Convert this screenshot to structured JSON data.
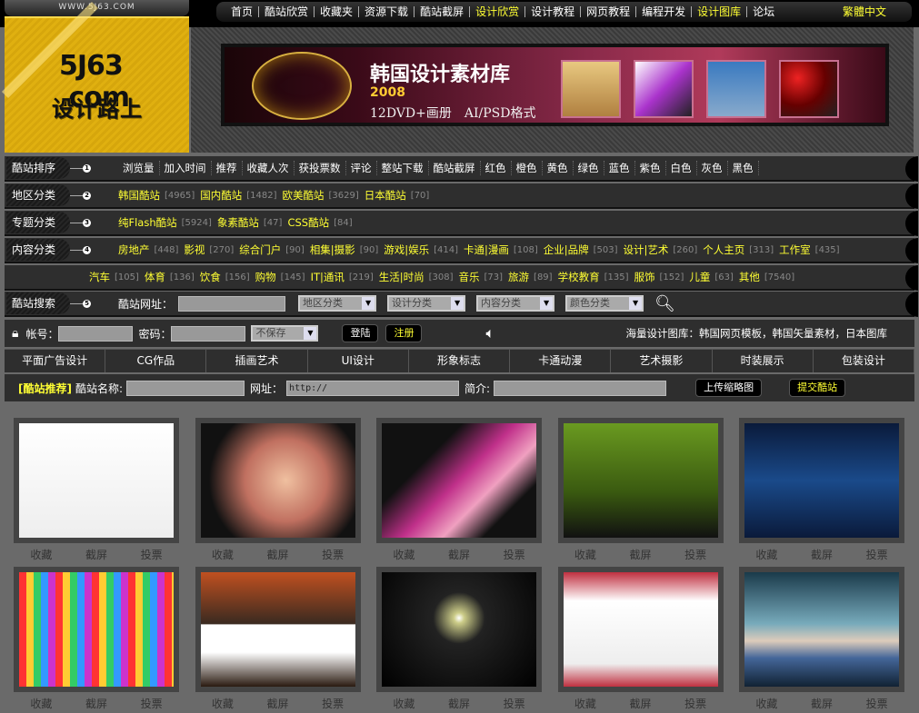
{
  "site_url": "WWW.5J63.COM",
  "logo": {
    "mark": "5J63 .com",
    "slogan": "设计路上"
  },
  "nav": [
    {
      "label": "首页"
    },
    {
      "label": "酷站欣赏"
    },
    {
      "label": "收藏夹"
    },
    {
      "label": "资源下载"
    },
    {
      "label": "酷站截屏"
    },
    {
      "label": "设计欣赏",
      "hl": true
    },
    {
      "label": "设计教程"
    },
    {
      "label": "网页教程"
    },
    {
      "label": "编程开发"
    },
    {
      "label": "设计图库",
      "hl": true
    },
    {
      "label": "论坛"
    }
  ],
  "nav_traditional": "繁體中文",
  "banner": {
    "title": "韩国设计素材库",
    "year": "2008",
    "subtitle": "12DVD+画册　AI/PSD格式"
  },
  "rows": {
    "sort": {
      "label": "酷站排序",
      "num": "1",
      "items": [
        "浏览量",
        "加入时间",
        "推荐",
        "收藏人次",
        "获投票数",
        "评论",
        "整站下载",
        "酷站截屏",
        "红色",
        "橙色",
        "黄色",
        "绿色",
        "蓝色",
        "紫色",
        "白色",
        "灰色",
        "黑色"
      ]
    },
    "region": {
      "label": "地区分类",
      "num": "2",
      "items": [
        {
          "name": "韩国酷站",
          "count": "[4965]"
        },
        {
          "name": "国内酷站",
          "count": "[1482]"
        },
        {
          "name": "欧美酷站",
          "count": "[3629]"
        },
        {
          "name": "日本酷站",
          "count": "[70]"
        }
      ]
    },
    "topic": {
      "label": "专题分类",
      "num": "3",
      "items": [
        {
          "name": "纯Flash酷站",
          "count": "[5924]"
        },
        {
          "name": "象素酷站",
          "count": "[47]"
        },
        {
          "name": "CSS酷站",
          "count": "[84]"
        }
      ]
    },
    "content": {
      "label": "内容分类",
      "num": "4",
      "items": [
        {
          "name": "房地产",
          "count": "[448]"
        },
        {
          "name": "影视",
          "count": "[270]"
        },
        {
          "name": "综合门户",
          "count": "[90]"
        },
        {
          "name": "相集|摄影",
          "count": "[90]"
        },
        {
          "name": "游戏|娱乐",
          "count": "[414]"
        },
        {
          "name": "卡通|漫画",
          "count": "[108]"
        },
        {
          "name": "企业|品牌",
          "count": "[503]"
        },
        {
          "name": "设计|艺术",
          "count": "[260]"
        },
        {
          "name": "个人主页",
          "count": "[313]"
        },
        {
          "name": "工作室",
          "count": "[435]"
        }
      ],
      "items2": [
        {
          "name": "汽车",
          "count": "[105]"
        },
        {
          "name": "体育",
          "count": "[136]"
        },
        {
          "name": "饮食",
          "count": "[156]"
        },
        {
          "name": "购物",
          "count": "[145]"
        },
        {
          "name": "IT|通讯",
          "count": "[219]"
        },
        {
          "name": "生活|时尚",
          "count": "[308]"
        },
        {
          "name": "音乐",
          "count": "[73]"
        },
        {
          "name": "旅游",
          "count": "[89]"
        },
        {
          "name": "学校教育",
          "count": "[135]"
        },
        {
          "name": "服饰",
          "count": "[152]"
        },
        {
          "name": "儿童",
          "count": "[63]"
        },
        {
          "name": "其他",
          "count": "[7540]"
        }
      ]
    },
    "search": {
      "label": "酷站搜索",
      "num": "5",
      "url_label": "酷站网址：",
      "selects": [
        "地区分类",
        "设计分类",
        "内容分类",
        "颜色分类"
      ]
    }
  },
  "login": {
    "account_label": "帐号：",
    "password_label": "密码：",
    "remember": "不保存",
    "login_btn": "登陆",
    "register_btn": "注册",
    "marquee": "海量设计图库：韩国网页模板，韩国矢量素材，日本图库"
  },
  "tabs": [
    "平面广告设计",
    "CG作品",
    "插画艺术",
    "UI设计",
    "形象标志",
    "卡通动漫",
    "艺术摄影",
    "时装展示",
    "包装设计"
  ],
  "recommend": {
    "tag": "[酷站推荐]",
    "name_label": "酷站名称:",
    "url_label": "网址：",
    "url_value": "http://",
    "intro_label": "简介:",
    "upload_btn": "上传缩略图",
    "submit_btn": "提交酷站"
  },
  "actions": [
    "收藏",
    "截屏",
    "投票"
  ],
  "thumbnails": [
    {
      "bg": "linear-gradient(#fff,#eee)"
    },
    {
      "bg": "radial-gradient(circle at 55% 50%,#f0c0a0,#c07060 40%,#111 75%)"
    },
    {
      "bg": "linear-gradient(135deg,#111 30%,#c0308a 50%,#f0a0c0 65%,#111 80%)"
    },
    {
      "bg": "linear-gradient(#6a9a20,#3a5a10 60%,#111)"
    },
    {
      "bg": "linear-gradient(#0a1a3a,#1a4a8a 50%,#0a1a3a)"
    },
    {
      "bg": "repeating-linear-gradient(90deg,#f33 0 8px,#fc3 8px 16px,#3c6 16px 24px,#39f 24px 32px,#c3c 32px 40px)"
    },
    {
      "bg": "linear-gradient(#c05020,#3a2a20 45%,#fff 46%,#fff 70%,#2a1a10)"
    },
    {
      "bg": "radial-gradient(circle at 50% 40%,#fff 0,#cc8 5%,#222 25%,#000)"
    },
    {
      "bg": "linear-gradient(#c03040,#fff 25%,#eee 80%,#c03040)"
    },
    {
      "bg": "linear-gradient(#1a3a4a,#7ab 45%,#dcb 60%,#469 75%,#123)"
    }
  ]
}
